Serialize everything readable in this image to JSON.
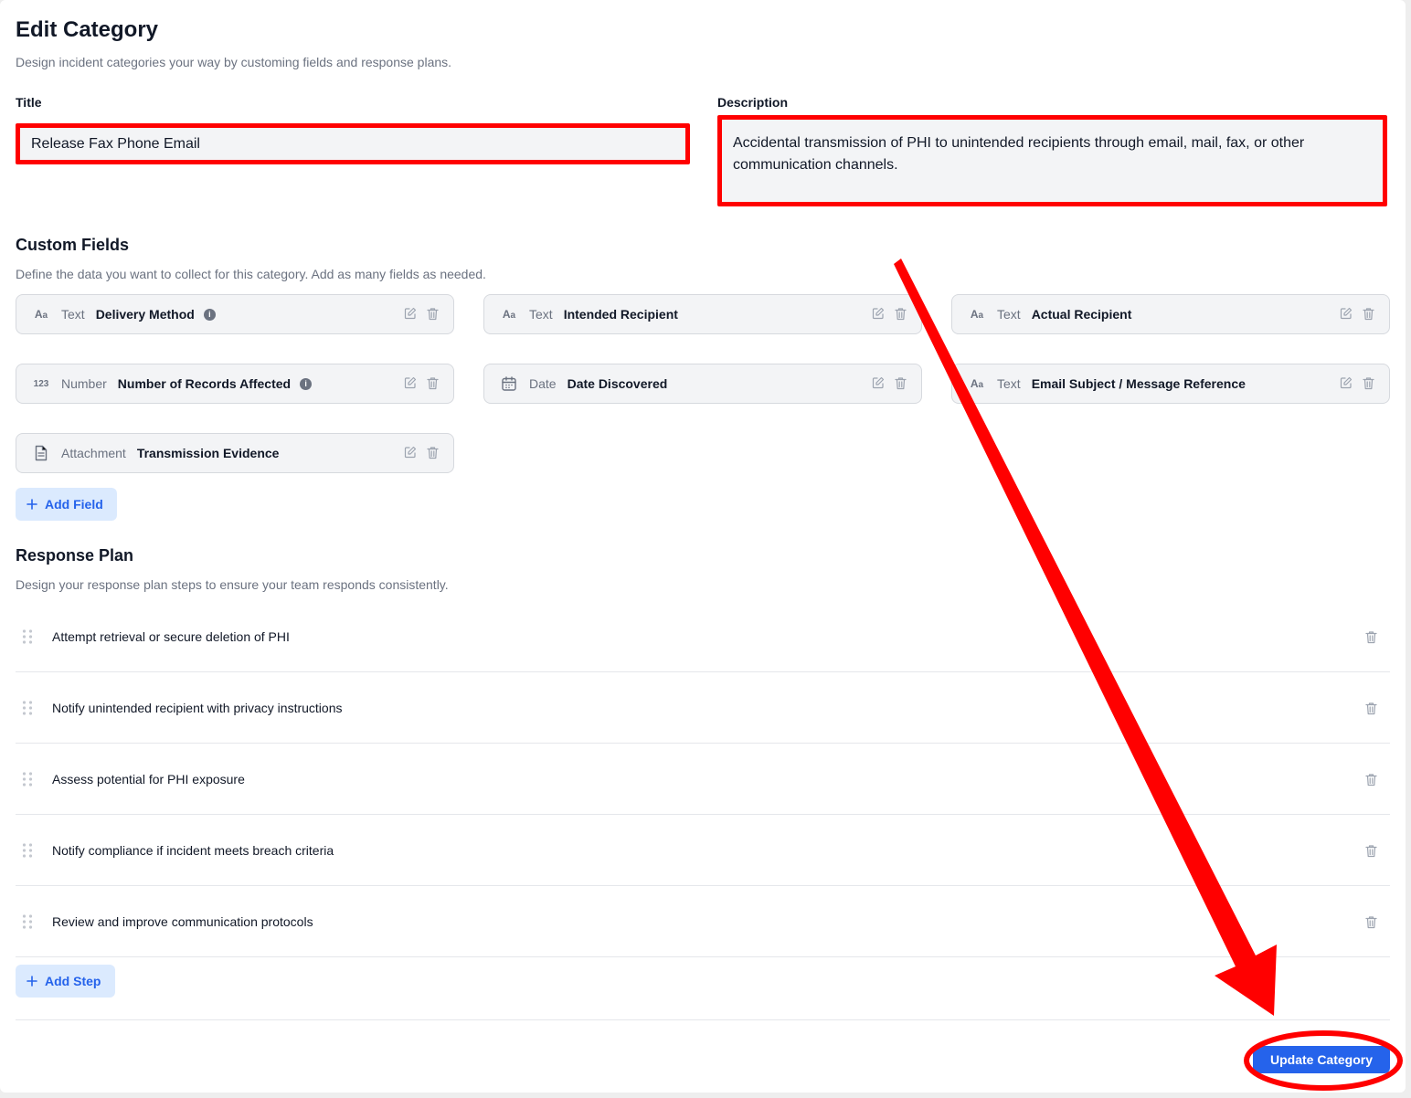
{
  "header": {
    "title": "Edit Category",
    "subtitle": "Design incident categories your way by customing fields and response plans."
  },
  "form": {
    "title_label": "Title",
    "title_value": "Release Fax Phone Email",
    "description_label": "Description",
    "description_value": "Accidental transmission of PHI to unintended recipients through email, mail, fax, or other communication channels."
  },
  "custom_fields": {
    "title": "Custom Fields",
    "subtitle": "Define the data you want to collect for this category. Add as many fields as needed.",
    "fields": [
      {
        "type": "Text",
        "name": "Delivery Method",
        "icon": "text-type-icon",
        "info": true
      },
      {
        "type": "Text",
        "name": "Intended Recipient",
        "icon": "text-type-icon",
        "info": false
      },
      {
        "type": "Text",
        "name": "Actual Recipient",
        "icon": "text-type-icon",
        "info": false
      },
      {
        "type": "Number",
        "name": "Number of Records Affected",
        "icon": "number-type-icon",
        "info": true
      },
      {
        "type": "Date",
        "name": "Date Discovered",
        "icon": "calendar-icon",
        "info": false
      },
      {
        "type": "Text",
        "name": "Email Subject / Message Reference",
        "icon": "text-type-icon",
        "info": false
      },
      {
        "type": "Attachment",
        "name": "Transmission Evidence",
        "icon": "document-icon",
        "info": false
      }
    ],
    "add_label": "Add Field"
  },
  "response_plan": {
    "title": "Response Plan",
    "subtitle": "Design your response plan steps to ensure your team responds consistently.",
    "steps": [
      "Attempt retrieval or secure deletion of PHI",
      "Notify unintended recipient with privacy instructions",
      "Assess potential for PHI exposure",
      "Notify compliance if incident meets breach criteria",
      "Review and improve communication protocols"
    ],
    "add_label": "Add Step"
  },
  "footer": {
    "update_label": "Update Category"
  },
  "colors": {
    "accent": "#2563eb",
    "annotation": "#ff0000"
  }
}
